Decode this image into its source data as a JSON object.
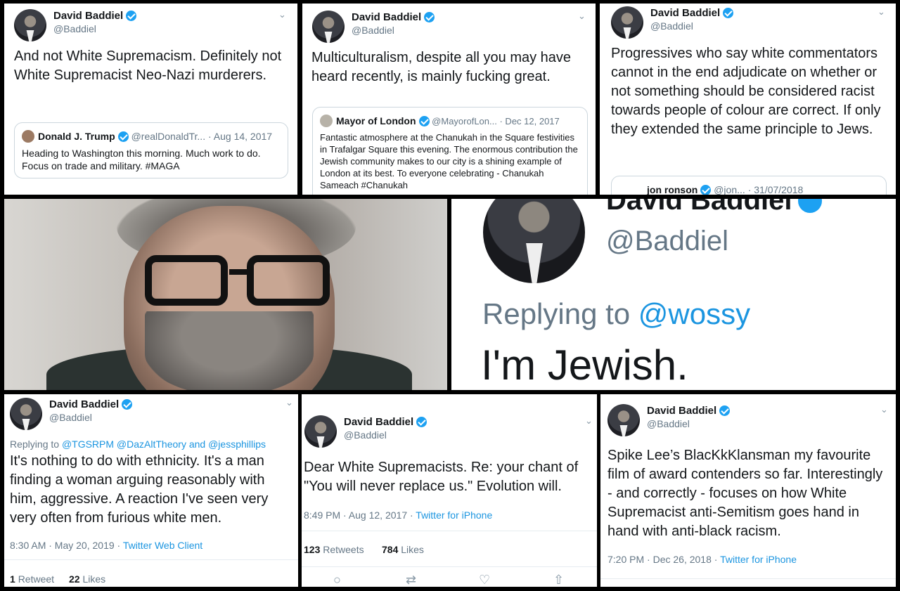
{
  "colors": {
    "link": "#1b95e0",
    "verified": "#1da1f2",
    "text": "#14171a",
    "secondary": "#657786"
  },
  "author": {
    "name": "David Baddiel",
    "handle": "@Baddiel"
  },
  "tweet1": {
    "text": "And not White Supremacism. Definitely not White Supremacist Neo-Nazi murderers.",
    "quote": {
      "name": "Donald J. Trump",
      "handle": "@realDonaldTr...",
      "date": "· Aug 14, 2017",
      "text": "Heading to Washington this morning. Much work to do. Focus on trade and military. #MAGA"
    }
  },
  "tweet2": {
    "text": "Multiculturalism, despite all you may have heard recently, is mainly fucking great.",
    "quote": {
      "name": "Mayor of London",
      "handle": "@MayorofLon...",
      "date": "· Dec 12, 2017",
      "text": "Fantastic atmosphere at the Chanukah in the Square festivities in Trafalgar Square this evening. The enormous contribution the Jewish community makes to our city is a shining example of London at its best. To everyone celebrating - Chanukah Sameach #Chanukah"
    }
  },
  "tweet3": {
    "text": "Progressives who say white commentators cannot in the end adjudicate on whether or not something should be considered racist towards people of colour are correct. If only they extended the same principle to Jews.",
    "quote": {
      "name": "jon ronson",
      "handle": "@jon...",
      "date": "· 31/07/2018"
    }
  },
  "zoomed": {
    "name": "David Baddiel",
    "handle": "@Baddiel",
    "replying_label": "Replying to",
    "replying_to": "@wossy",
    "text": "I'm Jewish."
  },
  "tweet4": {
    "replying_label": "Replying to",
    "replying_to": "@TGSRPM @DazAltTheory and @jessphillips",
    "text": "It's nothing to do with ethnicity. It's a man finding a woman arguing reasonably with him, aggressive. A reaction I've seen very very often from furious white men.",
    "time": "8:30 AM · May 20, 2019 ·",
    "client": "Twitter Web Client",
    "retweets_count": "1",
    "retweets_label": "Retweet",
    "likes_count": "22",
    "likes_label": "Likes"
  },
  "tweet5": {
    "text": "Dear White Supremacists. Re: your chant of \"You will never replace us.\"  Evolution will.",
    "time": "8:49 PM · Aug 12, 2017 ·",
    "client": "Twitter for iPhone",
    "retweets_count": "123",
    "retweets_label": "Retweets",
    "likes_count": "784",
    "likes_label": "Likes"
  },
  "tweet6": {
    "text": "Spike Lee’s BlacKkKlansman my favourite film of award contenders so far. Interestingly - and correctly - focuses on how White Supremacist anti-Semitism goes hand in hand with anti-black racism.",
    "time": "7:20 PM · Dec 26, 2018 ·",
    "client": "Twitter for iPhone"
  },
  "icons": [
    "verified-badge-icon",
    "chevron-down-icon",
    "reply-icon",
    "retweet-icon",
    "like-icon",
    "share-icon"
  ]
}
